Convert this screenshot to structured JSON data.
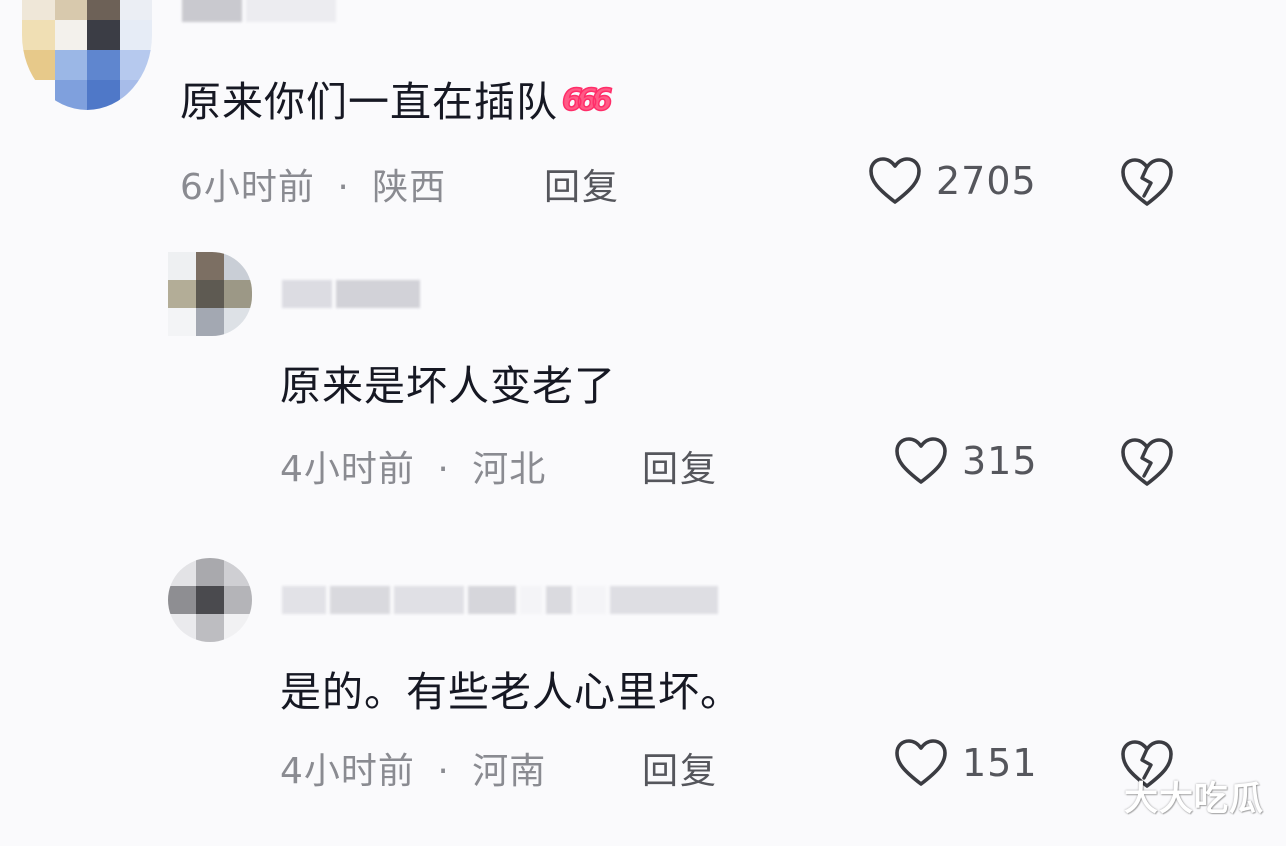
{
  "comments": [
    {
      "text": "原来你们一直在插队",
      "emoji": "666",
      "time": "6小时前",
      "separator": "·",
      "location": "陕西",
      "reply_label": "回复",
      "likes": "2705"
    },
    {
      "text": "原来是坏人变老了",
      "time": "4小时前",
      "separator": "·",
      "location": "河北",
      "reply_label": "回复",
      "likes": "315"
    },
    {
      "text": "是的。有些老人心里坏。",
      "time": "4小时前",
      "separator": "·",
      "location": "河南",
      "reply_label": "回复",
      "likes": "151"
    }
  ],
  "icons": {
    "like": "heart-outline-icon",
    "dislike": "broken-heart-icon"
  },
  "colors": {
    "text_primary": "#161823",
    "text_secondary": "#8a8b91",
    "emoji_pink": "#ff5a86"
  },
  "watermark": "大大吃瓜"
}
